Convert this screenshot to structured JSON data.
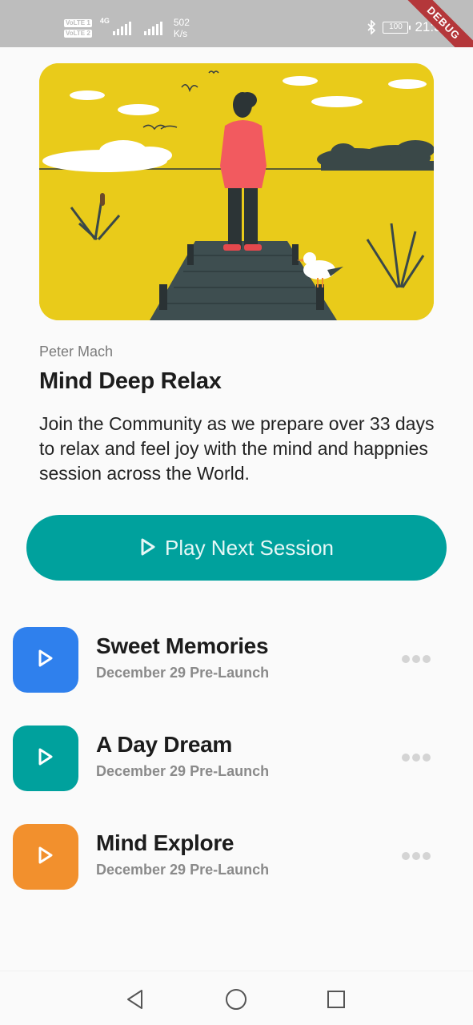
{
  "status_bar": {
    "volte_1": "VoLTE 1",
    "volte_2": "VoLTE 2",
    "network": "4G",
    "speed_value": "502",
    "speed_unit": "K/s",
    "battery": "100",
    "time": "21:33",
    "debug_label": "DEBUG"
  },
  "hero": {
    "illustration": "man-standing-on-pier-by-lake",
    "background_color": "#e9cb1a"
  },
  "content": {
    "author": "Peter Mach",
    "title": "Mind Deep Relax",
    "description": "Join the Community as we prepare over 33 days to relax and feel joy with the mind and happnies session across the World."
  },
  "play_button": {
    "label": "Play Next Session",
    "icon": "play-outline-icon",
    "color": "#00a19d"
  },
  "sessions": [
    {
      "title": "Sweet Memories",
      "subtitle": "December 29 Pre-Launch",
      "color": "#2f80ed",
      "icon": "play-icon"
    },
    {
      "title": "A Day Dream",
      "subtitle": "December 29 Pre-Launch",
      "color": "#00a19d",
      "icon": "play-icon"
    },
    {
      "title": "Mind Explore",
      "subtitle": "December 29 Pre-Launch",
      "color": "#f2902d",
      "icon": "play-icon"
    }
  ],
  "nav_bar": {
    "back_icon": "back-triangle-icon",
    "home_icon": "home-circle-icon",
    "recents_icon": "recents-square-icon"
  }
}
